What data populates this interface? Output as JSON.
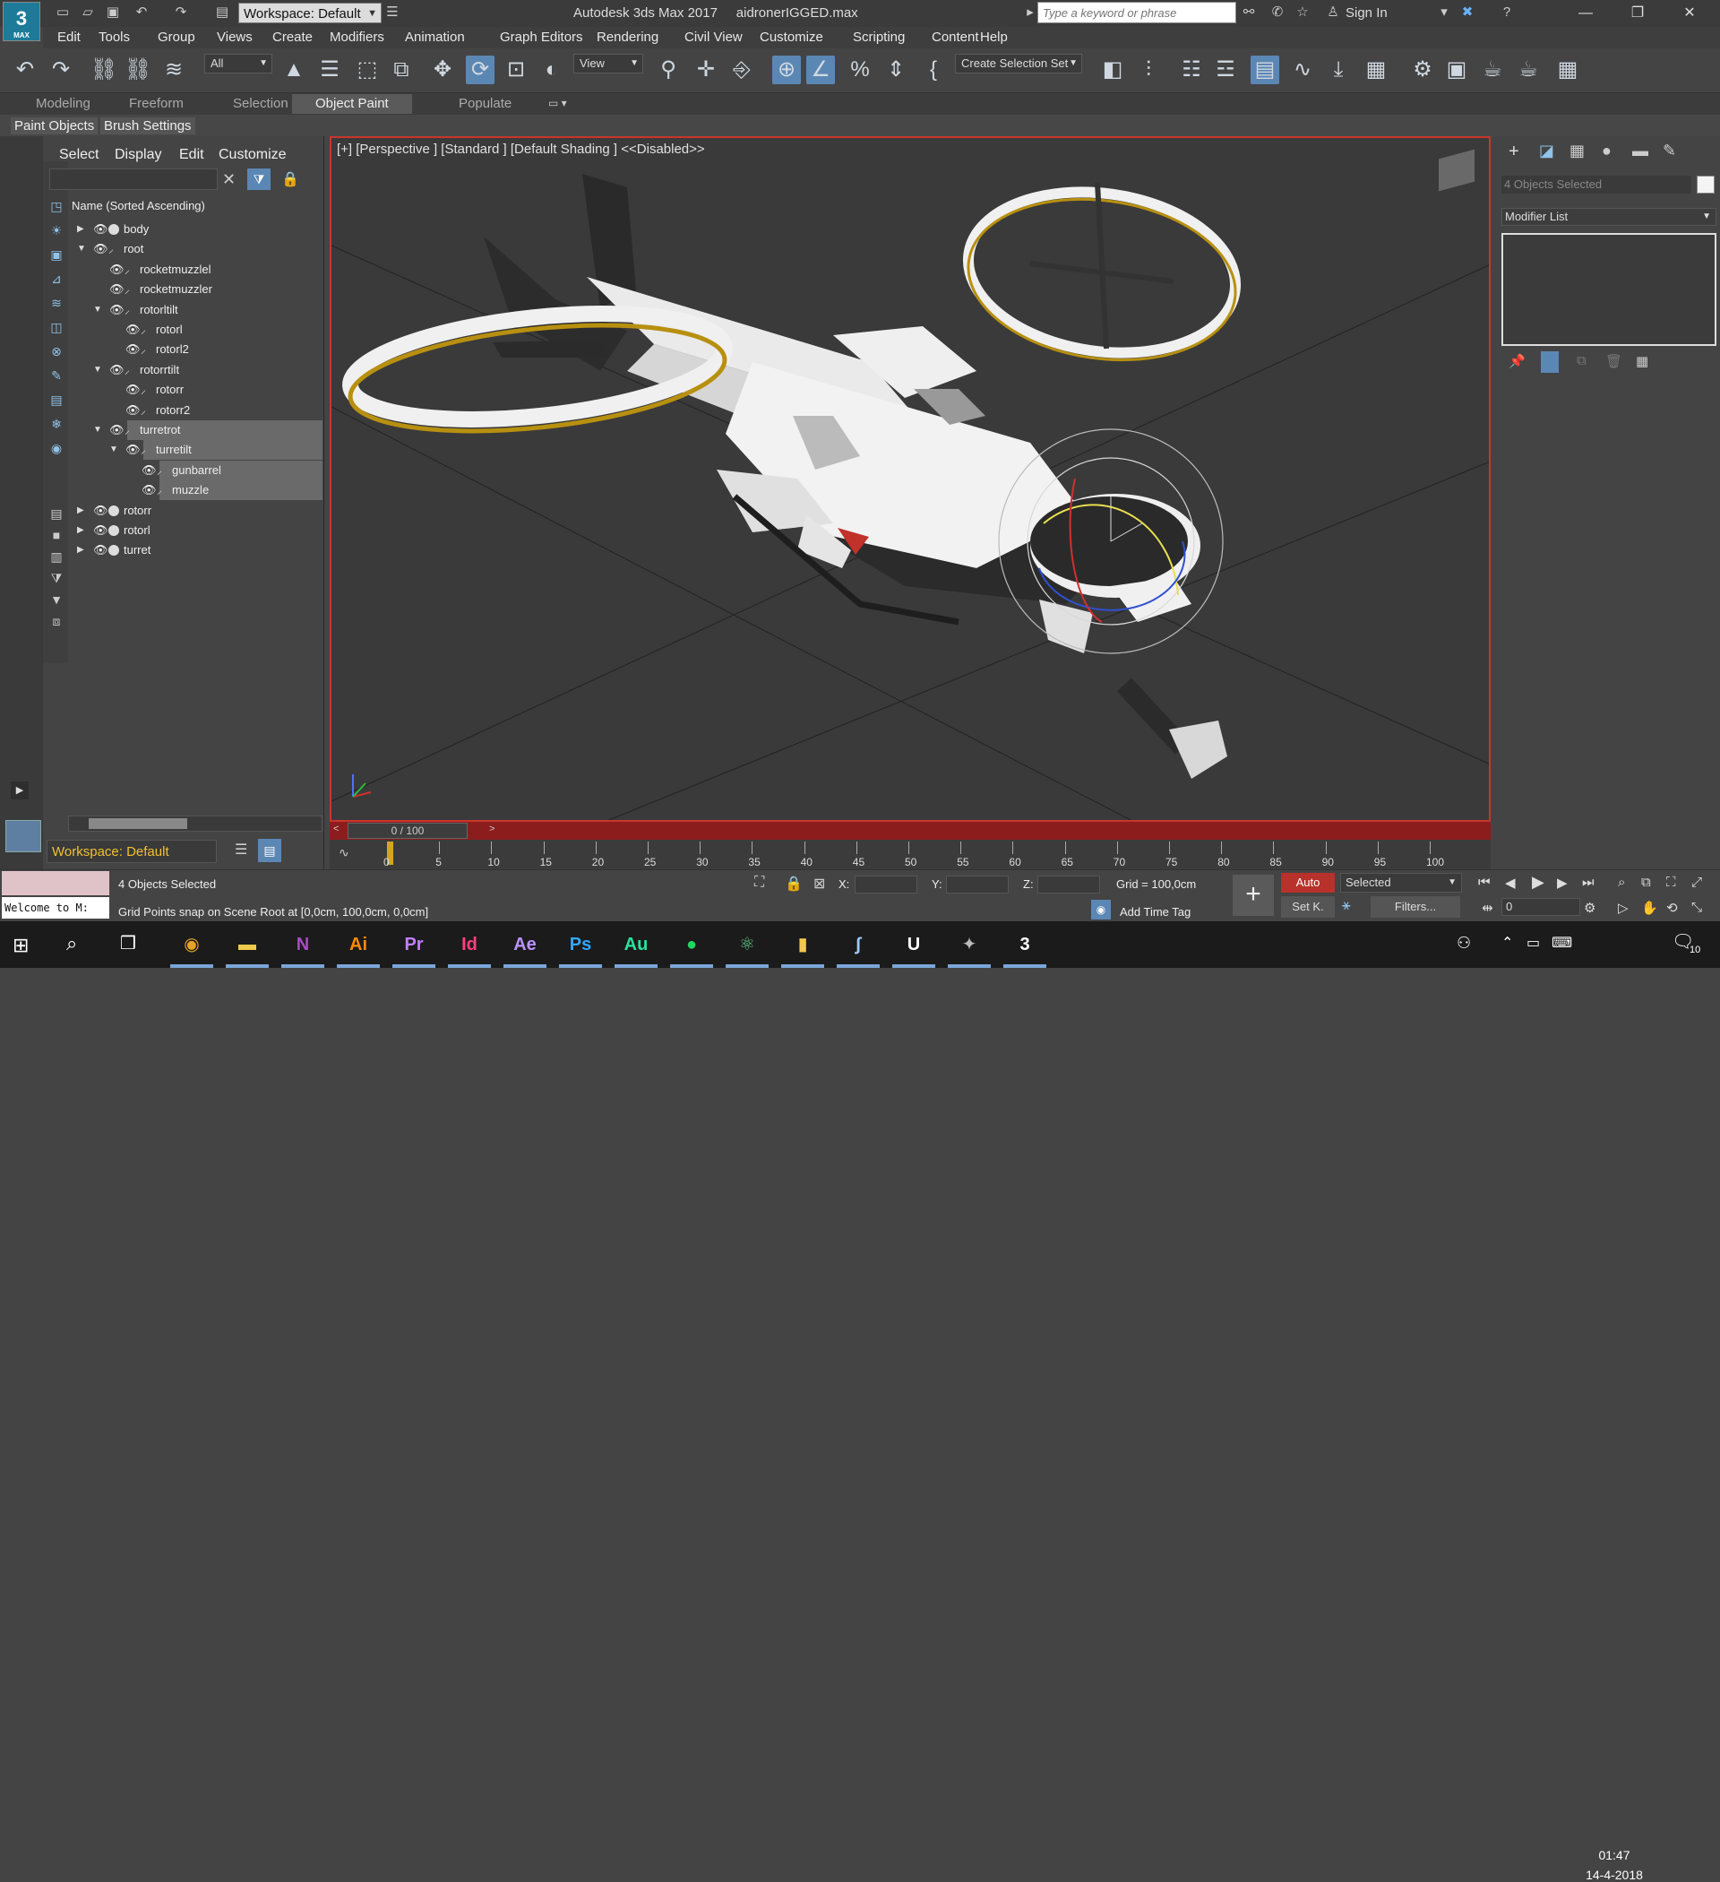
{
  "app": {
    "title": "Autodesk 3ds Max 2017",
    "filename": "aidronerIGGED.max",
    "logo_text": "3",
    "logo_sub": "MAX"
  },
  "titlebar": {
    "workspace": "Workspace: Default",
    "search_placeholder": "Type a keyword or phrase",
    "signin": "Sign In"
  },
  "menu": [
    "Edit",
    "Tools",
    "Group",
    "Views",
    "Create",
    "Modifiers",
    "Animation",
    "Graph Editors",
    "Rendering",
    "Civil View",
    "Customize",
    "Scripting",
    "Content",
    "Help"
  ],
  "toolbar": {
    "filter_all": "All",
    "refcoord": "View",
    "selection_set": "Create Selection Set"
  },
  "ribbon": {
    "tabs": [
      "Modeling",
      "Freeform",
      "Selection",
      "Object Paint",
      "Populate"
    ],
    "active_tab": "Object Paint",
    "sub": [
      "Paint Objects",
      "Brush Settings"
    ]
  },
  "scene_explorer": {
    "menus": [
      "Select",
      "Display",
      "Edit",
      "Customize"
    ],
    "header": "Name (Sorted Ascending)",
    "rows": [
      {
        "label": "body",
        "depth": 0,
        "expander": "closed",
        "icon": "sphere",
        "selected": false
      },
      {
        "label": "root",
        "depth": 0,
        "expander": "open",
        "icon": "bone",
        "selected": false
      },
      {
        "label": "rocketmuzzlel",
        "depth": 1,
        "expander": "none",
        "icon": "bone",
        "selected": false
      },
      {
        "label": "rocketmuzzler",
        "depth": 1,
        "expander": "none",
        "icon": "bone",
        "selected": false
      },
      {
        "label": "rotorltilt",
        "depth": 1,
        "expander": "open",
        "icon": "bone",
        "selected": false
      },
      {
        "label": "rotorl",
        "depth": 2,
        "expander": "none",
        "icon": "bone",
        "selected": false
      },
      {
        "label": "rotorl2",
        "depth": 2,
        "expander": "none",
        "icon": "bone",
        "selected": false
      },
      {
        "label": "rotorrtilt",
        "depth": 1,
        "expander": "open",
        "icon": "bone",
        "selected": false
      },
      {
        "label": "rotorr",
        "depth": 2,
        "expander": "none",
        "icon": "bone",
        "selected": false
      },
      {
        "label": "rotorr2",
        "depth": 2,
        "expander": "none",
        "icon": "bone",
        "selected": false
      },
      {
        "label": "turretrot",
        "depth": 1,
        "expander": "open",
        "icon": "bone",
        "selected": true
      },
      {
        "label": "turretilt",
        "depth": 2,
        "expander": "open",
        "icon": "bone",
        "selected": true
      },
      {
        "label": "gunbarrel",
        "depth": 3,
        "expander": "none",
        "icon": "bone",
        "selected": true
      },
      {
        "label": "muzzle",
        "depth": 3,
        "expander": "none",
        "icon": "bone",
        "selected": true
      },
      {
        "label": "rotorr",
        "depth": 0,
        "expander": "closed",
        "icon": "sphere",
        "selected": false
      },
      {
        "label": "rotorl",
        "depth": 0,
        "expander": "closed",
        "icon": "sphere",
        "selected": false
      },
      {
        "label": "turret",
        "depth": 0,
        "expander": "closed",
        "icon": "sphere",
        "selected": false
      }
    ],
    "workspace": "Workspace: Default"
  },
  "viewport": {
    "label": "[+] [Perspective ] [Standard ] [Default Shading ]  <<Disabled>>",
    "border_color": "#c9352c"
  },
  "timeline": {
    "slider": "0 / 100",
    "ticks": [
      "0",
      "5",
      "10",
      "15",
      "20",
      "25",
      "30",
      "35",
      "40",
      "45",
      "50",
      "55",
      "60",
      "65",
      "70",
      "75",
      "80",
      "85",
      "90",
      "95",
      "100"
    ]
  },
  "command_panel": {
    "objects_selected": "4 Objects Selected",
    "modifier_list": "Modifier List"
  },
  "status": {
    "objects_selected": "4 Objects Selected",
    "prompt": "Grid Points snap on Scene Root at [0,0cm, 100,0cm, 0,0cm]",
    "maxscript": "Welcome to M:",
    "x_label": "X:",
    "y_label": "Y:",
    "z_label": "Z:",
    "grid": "Grid = 100,0cm",
    "add_time_tag": "Add Time Tag",
    "auto": "Auto",
    "set_key": "Set K.",
    "selected": "Selected",
    "filters": "Filters...",
    "frame": "0"
  },
  "taskbar": {
    "time": "01:47",
    "date": "14-4-2018",
    "notifications": "10",
    "apps": [
      {
        "name": "chrome",
        "glyph": "◉",
        "color": "#e4a428"
      },
      {
        "name": "explorer",
        "glyph": "▬",
        "color": "#f2c94c"
      },
      {
        "name": "onenote",
        "glyph": "N",
        "color": "#a84bc2"
      },
      {
        "name": "illustrator",
        "glyph": "Ai",
        "color": "#ff8a00"
      },
      {
        "name": "premiere",
        "glyph": "Pr",
        "color": "#c47dff"
      },
      {
        "name": "indesign",
        "glyph": "Id",
        "color": "#ff3f7f"
      },
      {
        "name": "after-effects",
        "glyph": "Ae",
        "color": "#b993ff"
      },
      {
        "name": "photoshop",
        "glyph": "Ps",
        "color": "#33a8ff"
      },
      {
        "name": "audition",
        "glyph": "Au",
        "color": "#2de0a0"
      },
      {
        "name": "spotify",
        "glyph": "●",
        "color": "#1ed760"
      },
      {
        "name": "atom",
        "glyph": "⚛",
        "color": "#5fd38d"
      },
      {
        "name": "files",
        "glyph": "▮",
        "color": "#f2c94c"
      },
      {
        "name": "blender-like",
        "glyph": "∫",
        "color": "#9ecbff"
      },
      {
        "name": "unreal",
        "glyph": "U",
        "color": "#ffffff"
      },
      {
        "name": "tool",
        "glyph": "✦",
        "color": "#bbbbbb"
      },
      {
        "name": "3dsmax",
        "glyph": "3",
        "color": "#ffffff"
      }
    ]
  }
}
